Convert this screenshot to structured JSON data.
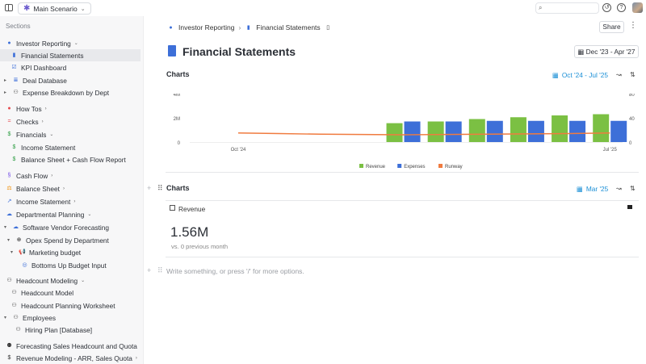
{
  "topbar": {
    "scenario_label": "Main Scenario",
    "search_placeholder": ""
  },
  "sidebar": {
    "sections_label": "Sections",
    "items": [
      {
        "label": "Investor Reporting",
        "icon": "info-circle-icon",
        "color": "#3d6fd8"
      },
      {
        "label": "Financial Statements",
        "icon": "document-icon",
        "color": "#3d6fd8"
      },
      {
        "label": "KPI Dashboard",
        "icon": "checkbox-icon",
        "color": "#3d6fd8"
      },
      {
        "label": "Deal Database",
        "icon": "database-icon",
        "color": "#3d6fd8"
      },
      {
        "label": "Expense Breakdown by Dept",
        "icon": "people-icon",
        "color": "#333333"
      },
      {
        "label": "How Tos",
        "icon": "question-icon",
        "color": "#e5484d"
      },
      {
        "label": "Checks",
        "icon": "equals-icon",
        "color": "#e5484d"
      },
      {
        "label": "Financials",
        "icon": "dollar-icon",
        "color": "#2f9e44"
      },
      {
        "label": "Income Statement",
        "icon": "dollar-icon",
        "color": "#2f9e44"
      },
      {
        "label": "Balance Sheet + Cash Flow Report",
        "icon": "dollar-icon",
        "color": "#2f9e44"
      },
      {
        "label": "Cash Flow",
        "icon": "cashflow-icon",
        "color": "#7048e8"
      },
      {
        "label": "Balance Sheet",
        "icon": "scale-icon",
        "color": "#f08c00"
      },
      {
        "label": "Income Statement",
        "icon": "trend-icon",
        "color": "#3d6fd8"
      },
      {
        "label": "Departmental Planning",
        "icon": "cloud-icon",
        "color": "#3d6fd8"
      },
      {
        "label": "Software Vendor Forecasting",
        "icon": "cloud-icon",
        "color": "#3d6fd8"
      },
      {
        "label": "Opex Spend by Department",
        "icon": "plus-circle-icon",
        "color": "#222222"
      },
      {
        "label": "Marketing budget",
        "icon": "megaphone-icon",
        "color": "#222222"
      },
      {
        "label": "Bottoms Up Budget Input",
        "icon": "target-icon",
        "color": "#3d6fd8"
      },
      {
        "label": "Headcount Modeling",
        "icon": "people-icon",
        "color": "#333333"
      },
      {
        "label": "Headcount Model",
        "icon": "people-icon",
        "color": "#333333"
      },
      {
        "label": "Headcount Planning Worksheet",
        "icon": "people-icon",
        "color": "#333333"
      },
      {
        "label": "Employees",
        "icon": "people-icon",
        "color": "#333333"
      },
      {
        "label": "Hiring Plan [Database]",
        "icon": "people-icon",
        "color": "#333333"
      },
      {
        "label": "Forecasting Sales Headcount and Quota",
        "icon": "person-icon",
        "color": "#333333"
      },
      {
        "label": "Revenue Modeling - ARR, Sales Quota",
        "icon": "dollar-icon",
        "color": "#333333"
      }
    ]
  },
  "main": {
    "breadcrumb": [
      "Investor Reporting",
      "Financial Statements"
    ],
    "share_label": "Share",
    "page_title": "Financial Statements",
    "date_range": "Dec '23 - Apr '27",
    "charts1": {
      "title": "Charts",
      "range": "Oct '24 - Jul '25"
    },
    "charts2": {
      "title": "Charts",
      "range": "Mar '25"
    },
    "kpi": {
      "label": "Revenue",
      "value": "1.56M",
      "sub": "vs. 0 previous month"
    },
    "editor_placeholder": "Write something, or press '/' for more options."
  },
  "chart_data": {
    "type": "bar",
    "categories": [
      "Oct '24",
      "Nov '24",
      "Dec '24",
      "Jan '25",
      "Feb '25",
      "Mar '25",
      "Apr '25",
      "May '25",
      "Jun '25",
      "Jul '25"
    ],
    "x_tick_labels": [
      "Oct '24",
      "Jul '25"
    ],
    "series": [
      {
        "name": "Revenue",
        "color": "#7bc043",
        "values": [
          null,
          null,
          null,
          null,
          1.56,
          1.7,
          1.9,
          2.05,
          2.2,
          2.3
        ]
      },
      {
        "name": "Expenses",
        "color": "#3d6fd8",
        "values": [
          null,
          null,
          null,
          null,
          1.7,
          1.7,
          1.75,
          1.75,
          1.75,
          1.75
        ]
      },
      {
        "name": "Runway",
        "color": "#f07b3f",
        "type": "line",
        "axis": "right",
        "values": [
          15,
          14,
          13,
          12.5,
          12,
          12.5,
          13,
          13.5,
          14,
          15
        ]
      }
    ],
    "y_left": {
      "ticks": [
        "0",
        "2M",
        "4M"
      ],
      "lim": [
        0,
        4
      ]
    },
    "y_right": {
      "ticks": [
        "0",
        "40",
        "80"
      ],
      "lim": [
        0,
        80
      ]
    },
    "legend": "bottom"
  }
}
